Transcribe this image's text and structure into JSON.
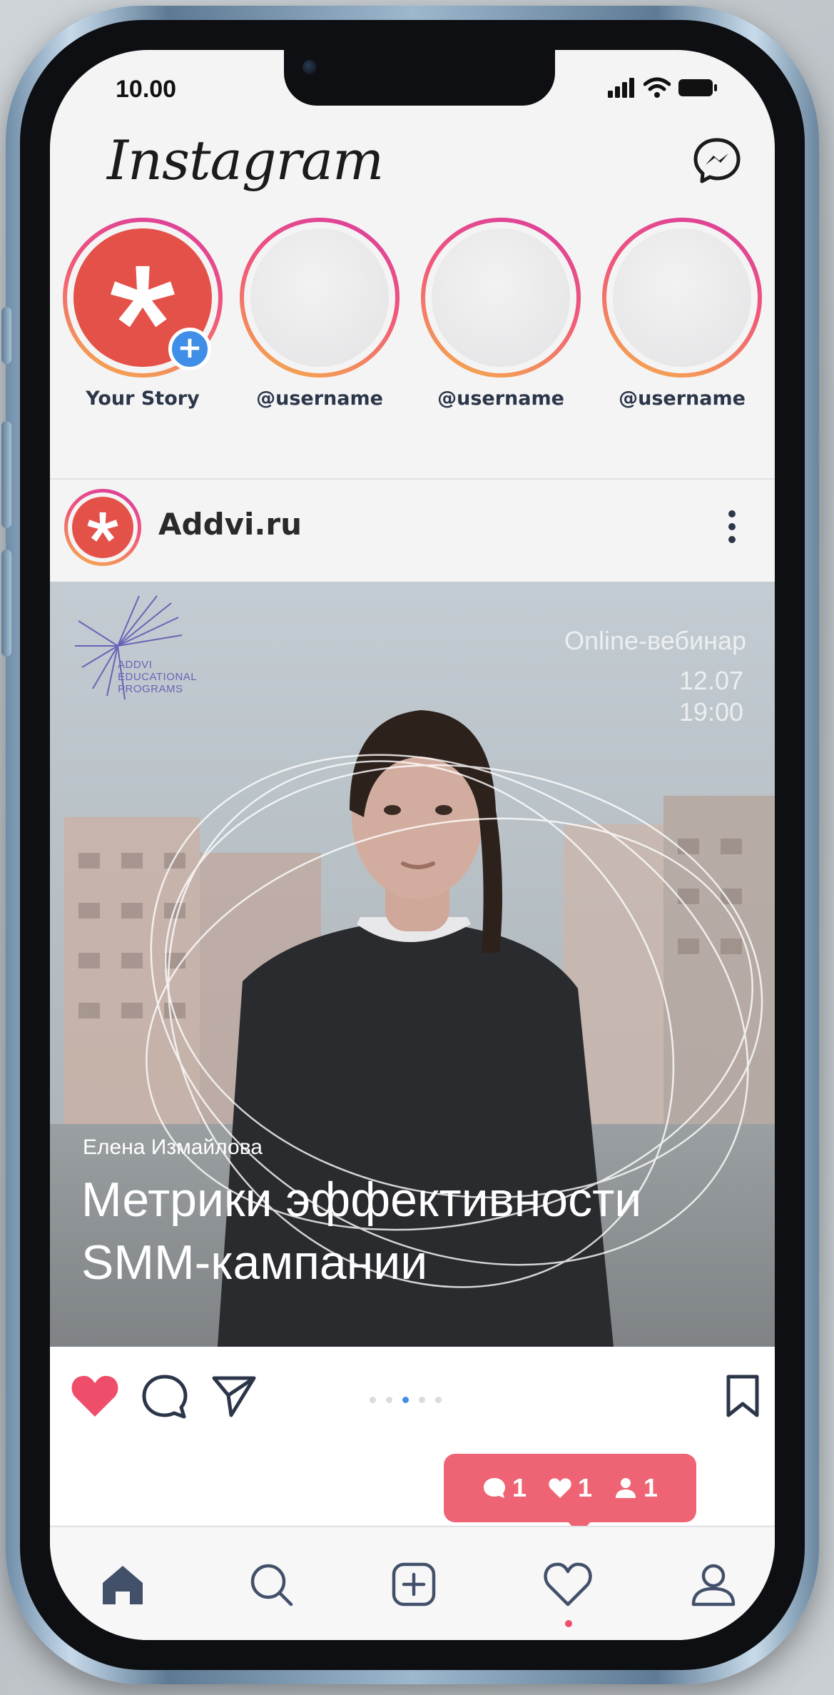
{
  "status_bar": {
    "time": "10.00",
    "icons": [
      "signal-icon",
      "wifi-icon",
      "battery-icon"
    ]
  },
  "header": {
    "app_name": "Instagram",
    "messenger_icon": "messenger-icon"
  },
  "stories": [
    {
      "name": "Your Story",
      "own": true
    },
    {
      "name": "@username",
      "own": false
    },
    {
      "name": "@username",
      "own": false
    },
    {
      "name": "@username",
      "own": false
    }
  ],
  "post": {
    "author": "Addvi.ru",
    "media": {
      "logo_text": [
        "ADDVI",
        "EDUCATIONAL",
        "PROGRAMS"
      ],
      "eyebrow": "Online-вебинар",
      "date": "12.07",
      "time": "19:00",
      "speaker": "Елена Измайлова",
      "headline_line1": "Метрики эффективности",
      "headline_line2": "SMM-кампании"
    },
    "carousel": {
      "count": 5,
      "active_index": 2
    },
    "liked": true
  },
  "notification": {
    "comments": "1",
    "likes": "1",
    "followers": "1"
  },
  "tabbar": [
    "home-icon",
    "search-icon",
    "create-icon",
    "activity-icon",
    "profile-icon"
  ],
  "colors": {
    "like_red": "#ef4e6a",
    "notification_bg": "#ef6474",
    "story_ring_start": "#d93ea0",
    "story_ring_end": "#f5b14a",
    "accent_blue": "#3f8ee8",
    "brand_red": "#e45149",
    "icon_navy": "#2c3649"
  }
}
